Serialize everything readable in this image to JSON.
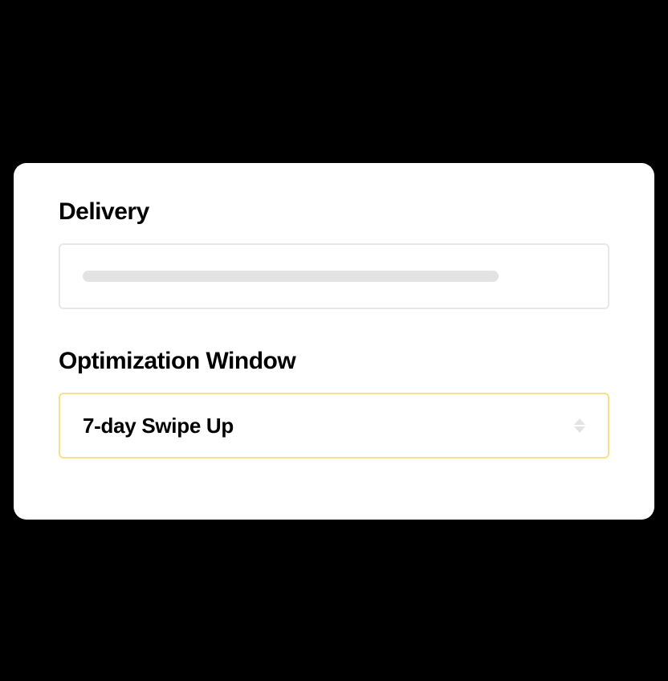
{
  "card": {
    "delivery": {
      "label": "Delivery"
    },
    "optimization_window": {
      "label": "Optimization Window",
      "selected": "7-day Swipe Up"
    }
  }
}
